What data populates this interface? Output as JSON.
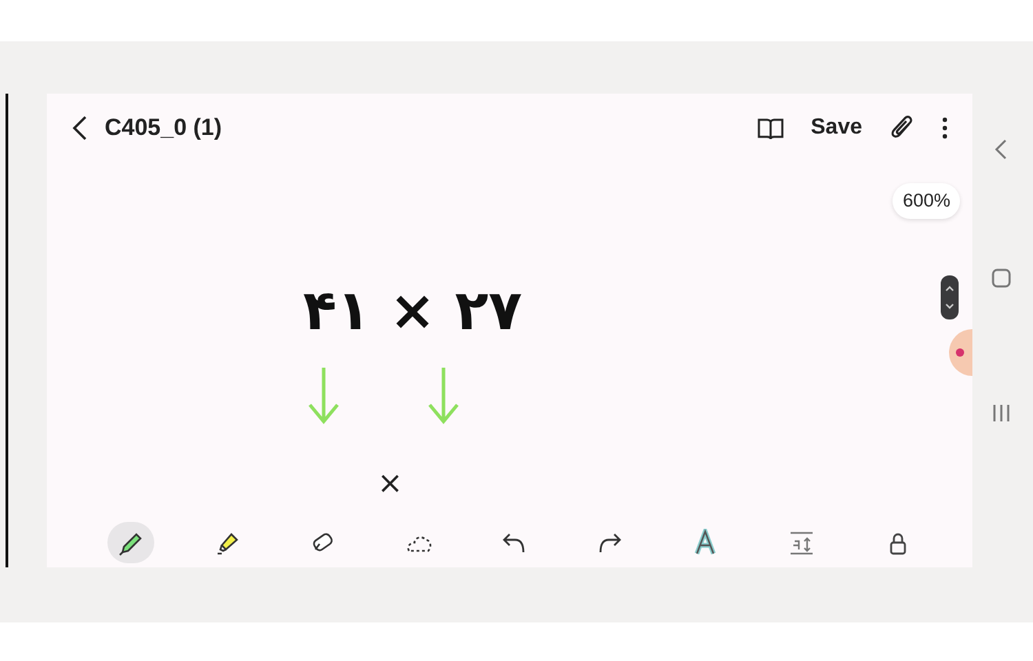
{
  "header": {
    "title": "C405_0 (1)",
    "save": "Save"
  },
  "canvas": {
    "zoom": "600%",
    "writing": [
      {
        "kind": "expression",
        "text": "۴۱ × ۲۷"
      },
      {
        "kind": "mark",
        "text": "×"
      }
    ]
  },
  "toolbar": [
    {
      "kind": "pen",
      "selected": true
    },
    {
      "kind": "highlighter",
      "selected": false
    },
    {
      "kind": "eraser",
      "selected": false
    },
    {
      "kind": "lasso",
      "selected": false
    },
    {
      "kind": "undo",
      "selected": false
    },
    {
      "kind": "redo",
      "selected": false
    },
    {
      "kind": "text-style",
      "selected": false
    },
    {
      "kind": "text-format",
      "selected": false
    },
    {
      "kind": "lock",
      "selected": false
    }
  ]
}
